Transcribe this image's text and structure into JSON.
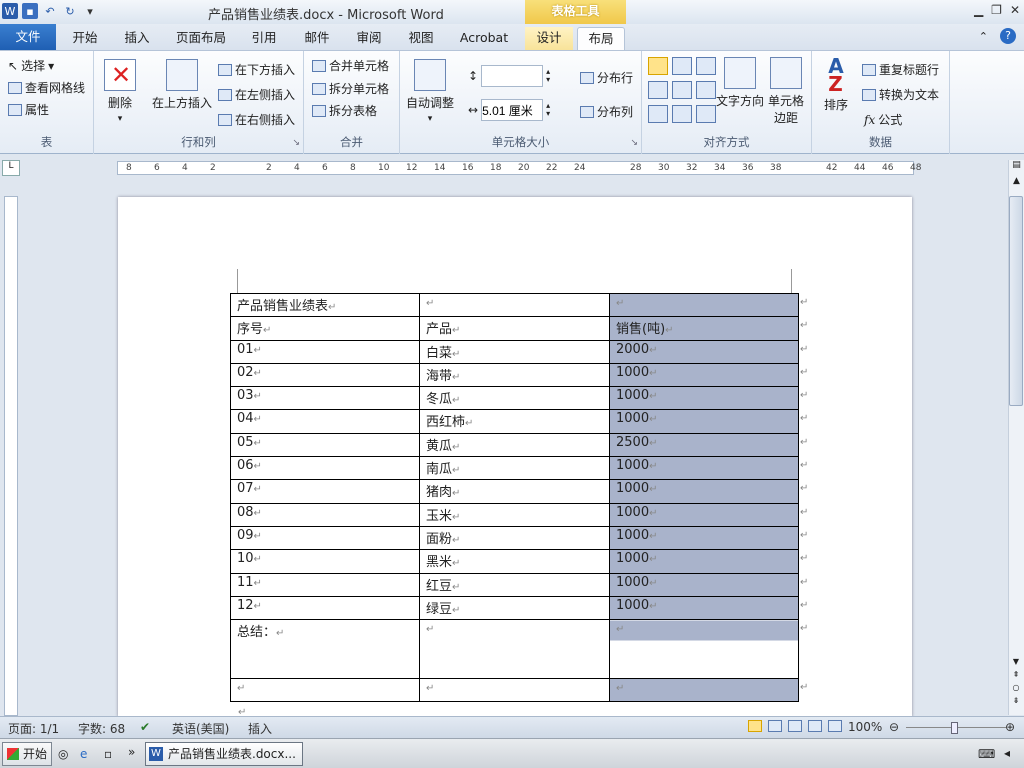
{
  "title_bar": {
    "doc_title": "产品销售业绩表.docx - Microsoft Word",
    "context_tab": "表格工具"
  },
  "tabs": [
    "文件",
    "开始",
    "插入",
    "页面布局",
    "引用",
    "邮件",
    "审阅",
    "视图",
    "Acrobat",
    "设计",
    "布局"
  ],
  "ribbon": {
    "table_group": {
      "select": "选择",
      "gridlines": "查看网格线",
      "properties": "属性",
      "label": "表"
    },
    "rows_cols": {
      "delete": "删除",
      "insert_above": "在上方插入",
      "insert_below": "在下方插入",
      "insert_left": "在左侧插入",
      "insert_right": "在右侧插入",
      "label": "行和列"
    },
    "merge": {
      "merge_cells": "合并单元格",
      "split_cells": "拆分单元格",
      "split_table": "拆分表格",
      "label": "合并"
    },
    "cell_size": {
      "autofit": "自动调整",
      "height_value": "",
      "width_value": "5.01 厘米",
      "dist_rows": "分布行",
      "dist_cols": "分布列",
      "label": "单元格大小"
    },
    "alignment": {
      "text_direction": "文字方向",
      "cell_margins": "单元格\n边距",
      "label": "对齐方式"
    },
    "data": {
      "sort": "排序",
      "repeat_header": "重复标题行",
      "convert_text": "转换为文本",
      "formula": "公式",
      "label": "数据"
    }
  },
  "ruler_numbers": [
    "8",
    "6",
    "4",
    "2",
    "2",
    "4",
    "6",
    "8",
    "10",
    "12",
    "14",
    "16",
    "18",
    "20",
    "22",
    "24",
    "28",
    "30",
    "32",
    "34",
    "36",
    "38",
    "42",
    "44",
    "46",
    "48"
  ],
  "table": {
    "title": "产品销售业绩表",
    "headers": [
      "序号",
      "产品",
      "销售(吨)"
    ],
    "rows": [
      [
        "01",
        "白菜",
        "2000"
      ],
      [
        "02",
        "海带",
        "1000"
      ],
      [
        "03",
        "冬瓜",
        "1000"
      ],
      [
        "04",
        "西红柿",
        "1000"
      ],
      [
        "05",
        "黄瓜",
        "2500"
      ],
      [
        "06",
        "南瓜",
        "1000"
      ],
      [
        "07",
        "猪肉",
        "1000"
      ],
      [
        "08",
        "玉米",
        "1000"
      ],
      [
        "09",
        "面粉",
        "1000"
      ],
      [
        "10",
        "黑米",
        "1000"
      ],
      [
        "11",
        "红豆",
        "1000"
      ],
      [
        "12",
        "绿豆",
        "1000"
      ]
    ],
    "summary_label": "总结：",
    "para_mark": "↵"
  },
  "status": {
    "page": "页面: 1/1",
    "words": "字数: 68",
    "language": "英语(美国)",
    "mode": "插入",
    "zoom": "100%"
  },
  "taskbar": {
    "start": "开始",
    "word_task": "产品销售业绩表.docx..."
  }
}
